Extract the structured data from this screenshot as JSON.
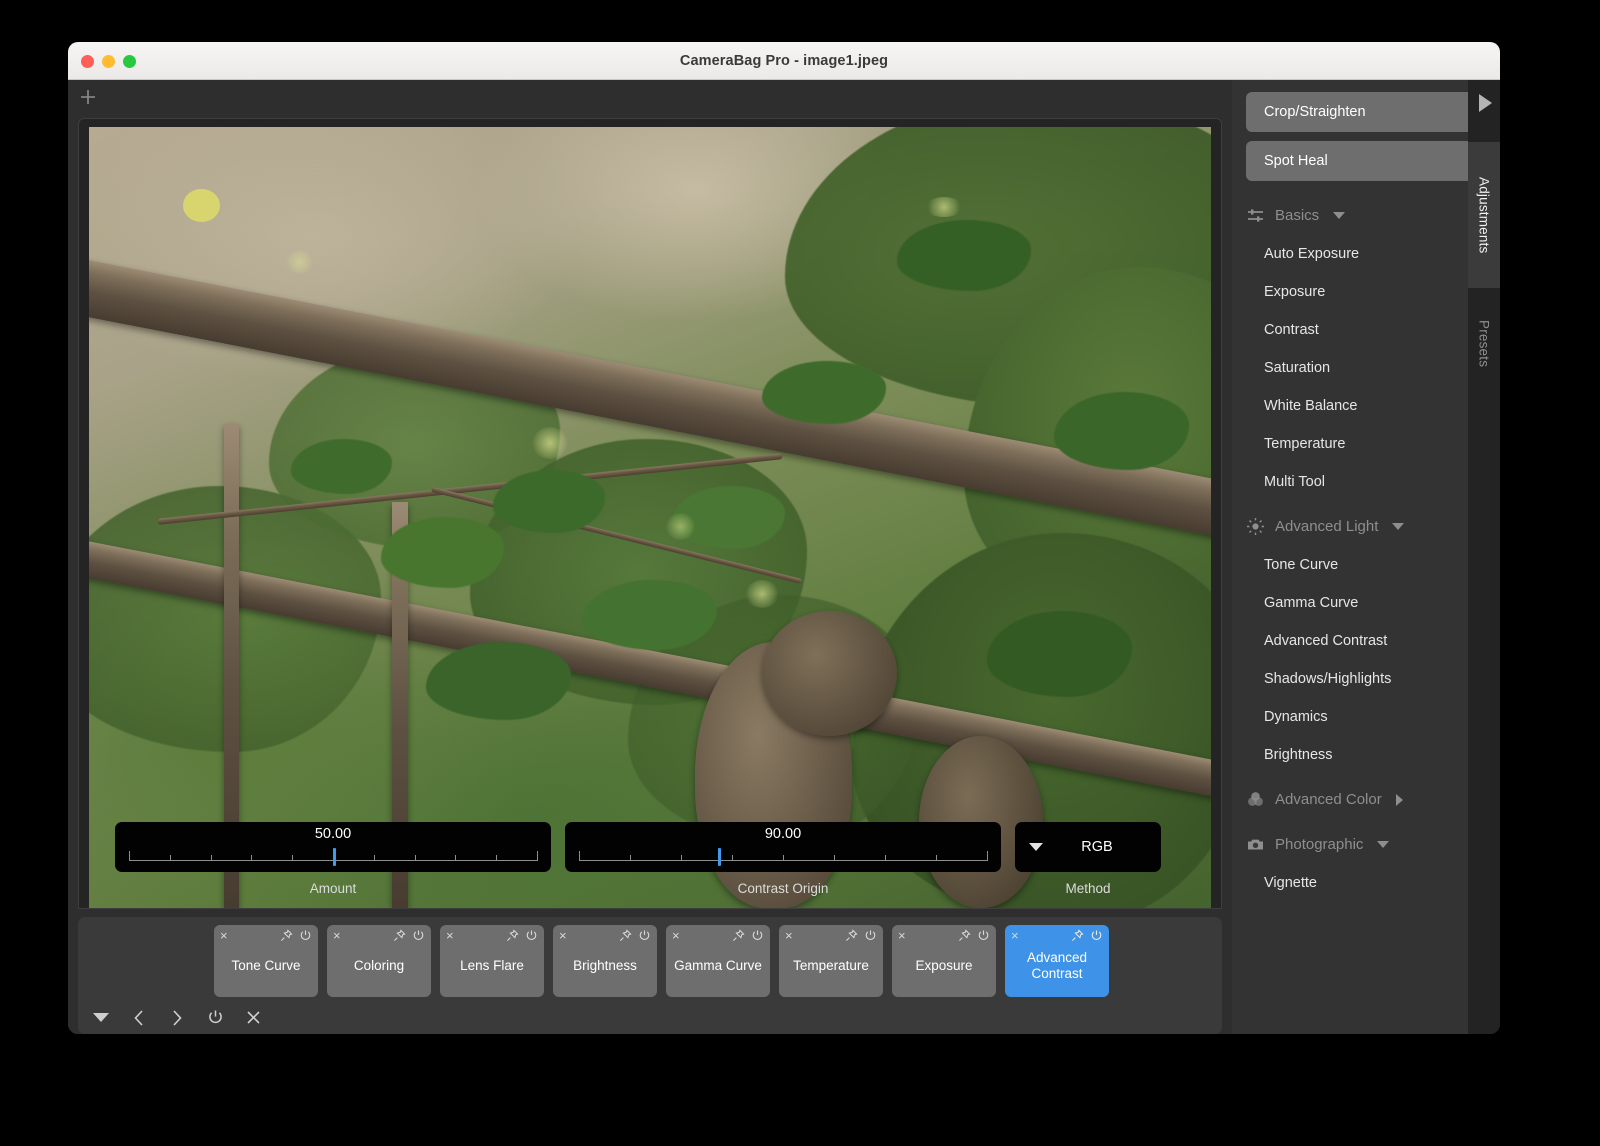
{
  "window": {
    "title": "CameraBag Pro - image1.jpeg",
    "traffic_lights": [
      "close-button",
      "minimize-button",
      "zoom-button"
    ]
  },
  "editor": {
    "add_icon": "plus-icon"
  },
  "sliders": [
    {
      "name": "amount",
      "label": "Amount",
      "value": "50.00",
      "thumb_percent": 50,
      "ticks": 11
    },
    {
      "name": "contrast-origin",
      "label": "Contrast Origin",
      "value": "90.00",
      "thumb_percent": 35,
      "ticks": 9
    }
  ],
  "method": {
    "label": "Method",
    "value": "RGB",
    "caret": "chevron-down-icon"
  },
  "filter_chips": [
    {
      "label": "Tone Curve",
      "active": false
    },
    {
      "label": "Coloring",
      "active": false
    },
    {
      "label": "Lens Flare",
      "active": false
    },
    {
      "label": "Brightness",
      "active": false
    },
    {
      "label": "Gamma Curve",
      "active": false
    },
    {
      "label": "Temperature",
      "active": false
    },
    {
      "label": "Exposure",
      "active": false
    },
    {
      "label": "Advanced Contrast",
      "active": true
    }
  ],
  "chip_controls": {
    "remove": "×",
    "pin": "pin-icon",
    "power": "power-icon"
  },
  "strip_toolbar": [
    {
      "name": "dropdown-caret",
      "glyph": ""
    },
    {
      "name": "previous",
      "glyph": "‹"
    },
    {
      "name": "next",
      "glyph": "›"
    },
    {
      "name": "power",
      "glyph": ""
    },
    {
      "name": "close",
      "glyph": "✕"
    }
  ],
  "sidebar": {
    "tool_buttons": [
      {
        "label": "Crop/Straighten"
      },
      {
        "label": "Spot Heal"
      }
    ],
    "groups": [
      {
        "name": "basics",
        "label": "Basics",
        "icon": "sliders-icon",
        "expanded": true,
        "items": [
          "Auto Exposure",
          "Exposure",
          "Contrast",
          "Saturation",
          "White Balance",
          "Temperature",
          "Multi Tool"
        ]
      },
      {
        "name": "advanced-light",
        "label": "Advanced Light",
        "icon": "sun-icon",
        "expanded": true,
        "items": [
          "Tone Curve",
          "Gamma Curve",
          "Advanced Contrast",
          "Shadows/Highlights",
          "Dynamics",
          "Brightness"
        ]
      },
      {
        "name": "advanced-color",
        "label": "Advanced Color",
        "icon": "color-circles-icon",
        "expanded": false,
        "items": []
      },
      {
        "name": "photographic",
        "label": "Photographic",
        "icon": "camera-icon",
        "expanded": true,
        "items": [
          "Vignette"
        ]
      }
    ]
  },
  "tab_rail": {
    "expand_icon": "play-triangle-icon",
    "tabs": [
      {
        "label": "Adjustments",
        "active": true
      },
      {
        "label": "Presets",
        "active": false
      }
    ]
  },
  "colors": {
    "accent": "#3e93e8",
    "slider_thumb": "#3e9bf0",
    "panel": "#333333",
    "chip": "#6e6e6e",
    "titlebar": "#f2f1ef"
  }
}
